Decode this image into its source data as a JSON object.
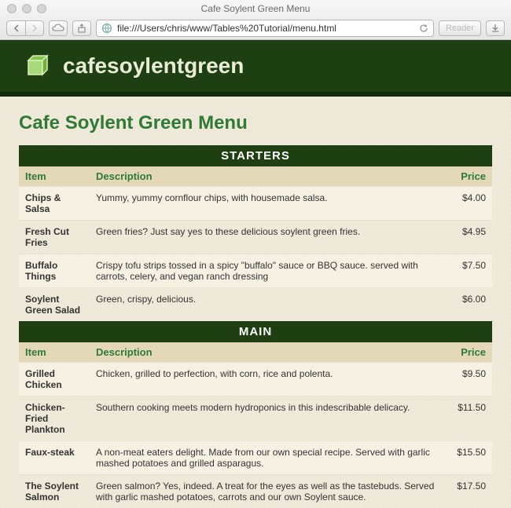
{
  "window": {
    "title": "Cafe Soylent Green Menu",
    "url": "file:///Users/chris/www/Tables%20Tutorial/menu.html",
    "reader_label": "Reader"
  },
  "page": {
    "brand": "cafesoylentgreen",
    "heading": "Cafe Soylent Green Menu"
  },
  "menu": {
    "columns": {
      "item": "Item",
      "desc": "Description",
      "price": "Price"
    },
    "sections": [
      {
        "title": "STARTERS",
        "rows": [
          {
            "item": "Chips & Salsa",
            "desc": "Yummy, yummy cornflour chips, with housemade salsa.",
            "price": "$4.00"
          },
          {
            "item": "Fresh Cut Fries",
            "desc": "Green fries? Just say yes to these delicious soylent green fries.",
            "price": "$4.95"
          },
          {
            "item": "Buffalo Things",
            "desc": "Crispy tofu strips tossed in a spicy \"buffalo\" sauce or BBQ sauce. served with carrots, celery, and vegan ranch dressing",
            "price": "$7.50"
          },
          {
            "item": "Soylent Green Salad",
            "desc": "Green, crispy, delicious.",
            "price": "$6.00"
          }
        ]
      },
      {
        "title": "MAIN",
        "rows": [
          {
            "item": "Grilled Chicken",
            "desc": "Chicken, grilled to perfection, with corn, rice and polenta.",
            "price": "$9.50"
          },
          {
            "item": "Chicken-Fried Plankton",
            "desc": "Southern cooking meets modern hydroponics in this indescribable delicacy.",
            "price": "$11.50"
          },
          {
            "item": "Faux-steak",
            "desc": "A non-meat eaters delight. Made from our own special recipe. Served with garlic mashed potatoes and grilled asparagus.",
            "price": "$15.50"
          },
          {
            "item": "The Soylent Salmon",
            "desc": "Green salmon? Yes, indeed. A treat for the eyes as well as the tastebuds. Served with garlic mashed potatoes, carrots and our own Soylent sauce.",
            "price": "$17.50"
          }
        ]
      }
    ]
  }
}
